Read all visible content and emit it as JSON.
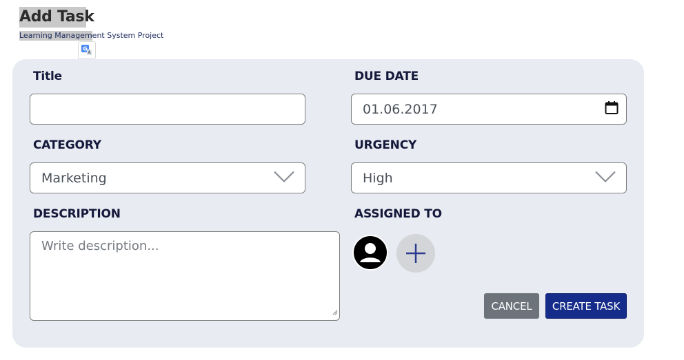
{
  "header": {
    "title": "Add Task",
    "subtitle_highlighted": "Learning Managem",
    "subtitle_rest": "ent System Project"
  },
  "form": {
    "title": {
      "label": "Title",
      "value": "",
      "placeholder": ""
    },
    "due_date": {
      "label": "DUE DATE",
      "value": "01.06.2017",
      "icon": "calendar-icon"
    },
    "category": {
      "label": "CATEGORY",
      "selected": "Marketing",
      "icon": "chevron-down-icon"
    },
    "urgency": {
      "label": "URGENCY",
      "selected": "High",
      "icon": "chevron-down-icon"
    },
    "description": {
      "label": "DESCRIPTION",
      "placeholder": "Write description..."
    },
    "assigned_to": {
      "label": "ASSIGNED TO",
      "avatar_icon": "user-avatar-icon",
      "add_icon": "plus-icon"
    }
  },
  "actions": {
    "cancel_label": "CANCEL",
    "create_label": "CREATE TASK"
  },
  "colors": {
    "panel_bg": "#e8ebf1",
    "label_text": "#14183a",
    "create_button": "#152c8a",
    "cancel_button": "#6c737b",
    "plus_icon": "#2a3b8f"
  }
}
